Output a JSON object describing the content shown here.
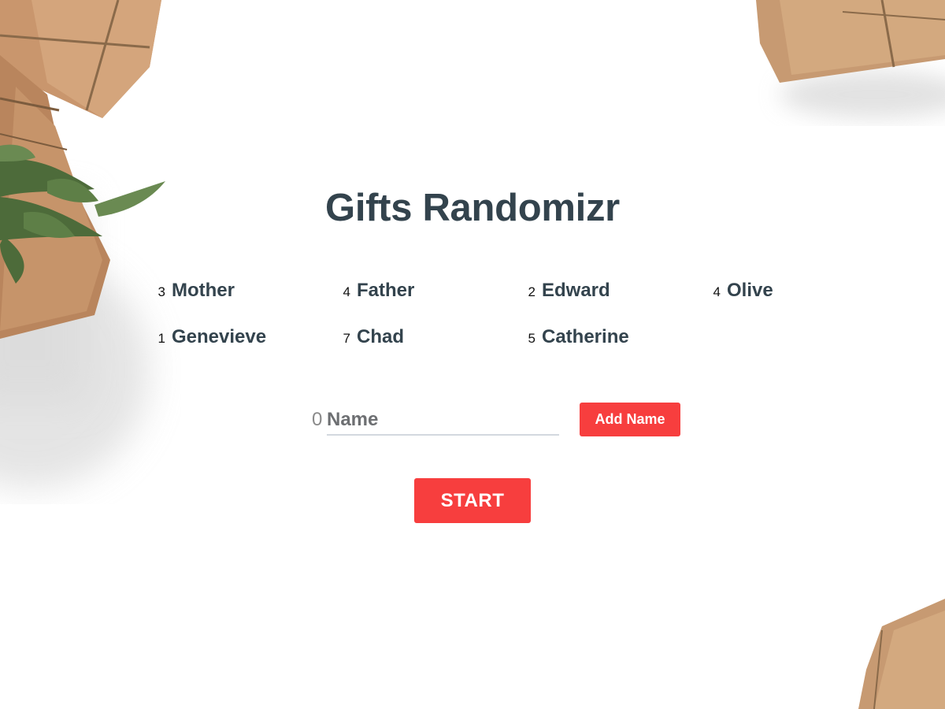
{
  "app": {
    "title": "Gifts Randomizr"
  },
  "participants": [
    {
      "count": "3",
      "name": "Mother"
    },
    {
      "count": "4",
      "name": "Father"
    },
    {
      "count": "2",
      "name": "Edward"
    },
    {
      "count": "4",
      "name": "Olive"
    },
    {
      "count": "1",
      "name": "Genevieve"
    },
    {
      "count": "7",
      "name": "Chad"
    },
    {
      "count": "5",
      "name": "Catherine"
    }
  ],
  "add_form": {
    "count": "0",
    "name_value": "",
    "name_placeholder": "Name",
    "add_label": "Add Name"
  },
  "start": {
    "label": "START"
  },
  "colors": {
    "accent": "#f73e3e",
    "text": "#33434d",
    "background": "#ffffff"
  },
  "decorations": [
    "kraft-paper-gift-top-left",
    "cedar-sprig",
    "kraft-paper-gift-left",
    "kraft-paper-gift-top-right",
    "kraft-paper-gift-bottom-right"
  ]
}
